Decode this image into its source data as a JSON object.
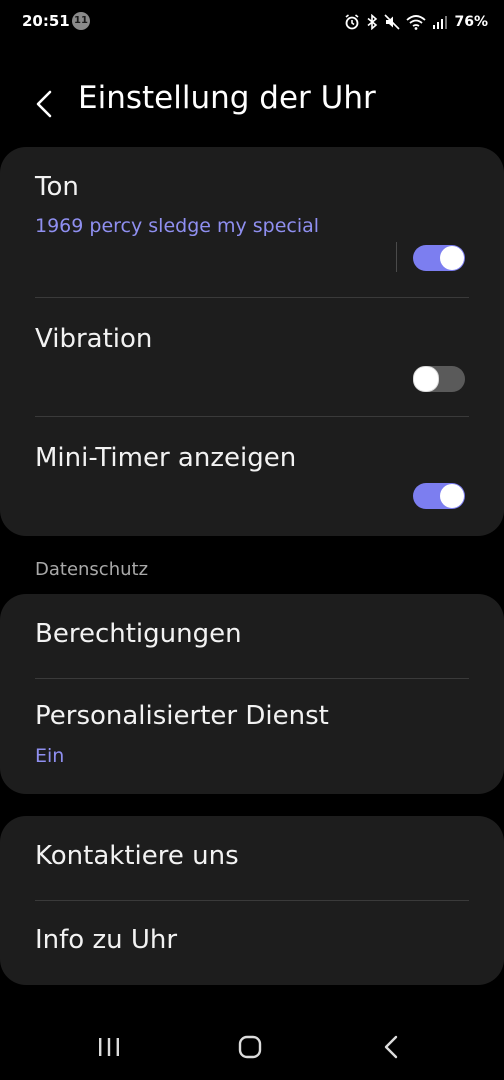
{
  "status_bar": {
    "time": "20:51",
    "notification_count": "11",
    "battery": "76%",
    "icons": [
      "alarm-icon",
      "bluetooth-icon",
      "mute-icon",
      "wifi-icon",
      "signal-icon"
    ]
  },
  "header": {
    "title": "Einstellung der Uhr"
  },
  "settings": {
    "sound": {
      "title": "Ton",
      "subtitle": "1969 percy sledge my special",
      "enabled": true
    },
    "vibration": {
      "title": "Vibration",
      "enabled": false
    },
    "mini_timer": {
      "title": "Mini-Timer anzeigen",
      "enabled": true
    }
  },
  "privacy": {
    "section_label": "Datenschutz",
    "permissions": {
      "title": "Berechtigungen"
    },
    "personalized_service": {
      "title": "Personalisierter Dienst",
      "subtitle": "Ein"
    }
  },
  "more": {
    "contact": {
      "title": "Kontaktiere uns"
    },
    "about": {
      "title": "Info zu Uhr"
    }
  },
  "nav_bar": {
    "buttons": [
      "recents-icon",
      "home-icon",
      "back-nav-icon"
    ]
  },
  "colors": {
    "accent": "#7c7ef0",
    "subtitle": "#8f8ff0",
    "card": "#1d1d1d",
    "background": "#000000"
  }
}
